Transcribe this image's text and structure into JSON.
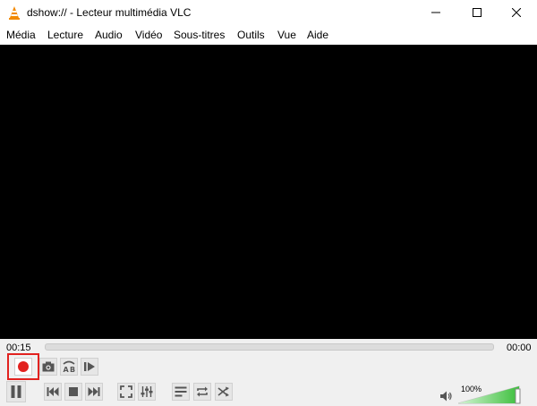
{
  "window": {
    "title": "dshow:// - Lecteur multimédia VLC",
    "icon": "vlc-cone-icon",
    "controls": [
      "minimize-icon",
      "maximize-icon",
      "close-icon"
    ]
  },
  "menu": {
    "items": [
      {
        "label": "Média"
      },
      {
        "label": "Lecture"
      },
      {
        "label": "Audio"
      },
      {
        "label": "Vidéo"
      },
      {
        "label": "Sous-titres"
      },
      {
        "label": "Outils"
      },
      {
        "label": "Vue"
      },
      {
        "label": "Aide"
      }
    ]
  },
  "playback": {
    "elapsed": "00:15",
    "total": "00:00",
    "seek_fraction": 0
  },
  "advanced_controls": {
    "record_icon": "record-icon",
    "snapshot_icon": "camera-icon",
    "loop_ab_icon": "ab-loop-icon",
    "frame_step_icon": "frame-step-icon",
    "highlight_color": "#e2221f",
    "record_color": "#e2221f"
  },
  "main_controls": {
    "pause_icon": "pause-icon",
    "previous_icon": "previous-icon",
    "stop_icon": "stop-icon",
    "next_icon": "next-icon",
    "fullscreen_icon": "fullscreen-icon",
    "effects_icon": "equalizer-icon",
    "playlist_icon": "playlist-icon",
    "loop_icon": "loop-icon",
    "shuffle_icon": "shuffle-icon"
  },
  "volume": {
    "label": "100%",
    "level_percent": 100,
    "icon": "speaker-icon",
    "fill_color": "#3cbf3c"
  }
}
